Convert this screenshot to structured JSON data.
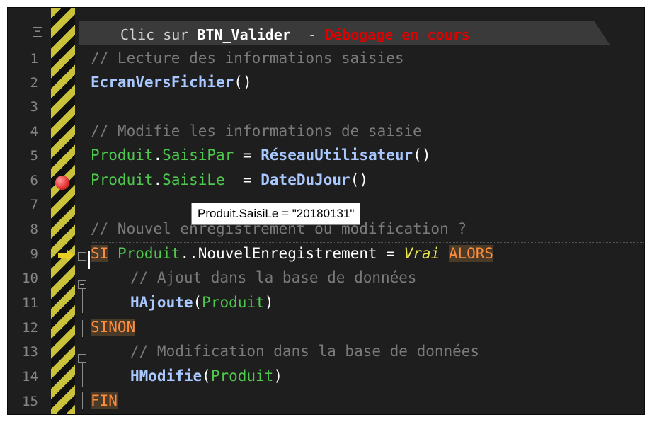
{
  "header": {
    "collapse_symbol": "⊟",
    "prefix": "Clic sur ",
    "control": "BTN_Valider",
    "separator": "  - ",
    "status": "Débogage en cours"
  },
  "line_numbers": [
    "1",
    "2",
    "3",
    "4",
    "5",
    "6",
    "7",
    "8",
    "9",
    "10",
    "11",
    "12",
    "13",
    "14",
    "15"
  ],
  "code": {
    "l1_comment": "// Lecture des informations saisies",
    "l2_fn": "EcranVersFichier",
    "l2_parens": "()",
    "l4_comment": "// Modifie les informations de saisie",
    "l5_obj": "Produit",
    "l5_dot": ".",
    "l5_prop": "SaisiPar",
    "l5_eq": " = ",
    "l5_fn": "RéseauUtilisateur",
    "l5_parens": "()",
    "l6_obj": "Produit",
    "l6_dot": ".",
    "l6_prop": "SaisiLe",
    "l6_eq": "  = ",
    "l6_fn": "DateDuJour",
    "l6_parens": "()",
    "l8_comment": "// Nouvel enregistrement ou modification ?",
    "l9_kw": "SI",
    "l9_obj": "Produit",
    "l9_dots": "..",
    "l9_prop": "NouvelEnregistrement",
    "l9_eq": " = ",
    "l9_val": "Vrai",
    "l9_kw2": "ALORS",
    "l10_comment": "// Ajout dans la base de données",
    "l11_fn": "HAjoute",
    "l11_open": "(",
    "l11_arg": "Produit",
    "l11_close": ")",
    "l12_kw": "SINON",
    "l13_comment": "// Modification dans la base de données",
    "l14_fn": "HModifie",
    "l14_open": "(",
    "l14_arg": "Produit",
    "l14_close": ")",
    "l15_kw": "FIN"
  },
  "tooltip": {
    "text": "Produit.SaisiLe = \"20180131\""
  },
  "debug": {
    "breakpoint_line": 6,
    "current_line": 9
  }
}
